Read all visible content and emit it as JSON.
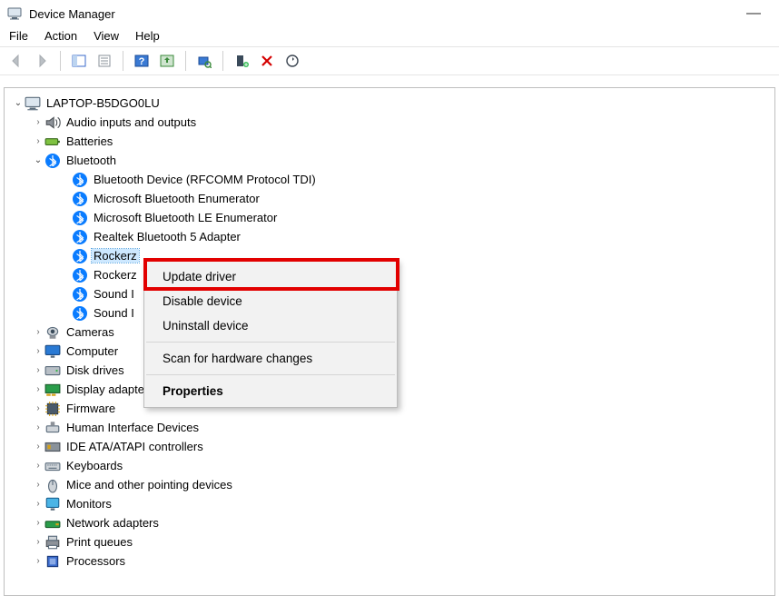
{
  "window": {
    "title": "Device Manager",
    "controls": {
      "minimize": "—"
    }
  },
  "menubar": [
    "File",
    "Action",
    "View",
    "Help"
  ],
  "toolbar": {
    "back": "Back",
    "forward": "Forward",
    "show_hidden": "Show hidden devices",
    "properties": "Properties",
    "help": "Help",
    "update": "Update",
    "uninstall": "Uninstall",
    "scan": "Scan for hardware changes",
    "add_legacy": "Add legacy hardware",
    "delete": "Delete",
    "refresh": "Refresh"
  },
  "tree": {
    "root": {
      "label": "LAPTOP-B5DGO0LU",
      "expanded": true
    },
    "categories": [
      {
        "id": "audio",
        "label": "Audio inputs and outputs",
        "icon": "speaker",
        "expanded": false
      },
      {
        "id": "battery",
        "label": "Batteries",
        "icon": "battery",
        "expanded": false
      },
      {
        "id": "bt",
        "label": "Bluetooth",
        "icon": "bluetooth",
        "expanded": true,
        "children": [
          {
            "label": "Bluetooth Device (RFCOMM Protocol TDI)"
          },
          {
            "label": "Microsoft Bluetooth Enumerator"
          },
          {
            "label": "Microsoft Bluetooth LE Enumerator"
          },
          {
            "label": "Realtek Bluetooth 5 Adapter"
          },
          {
            "label": "Rockerz",
            "selected": true
          },
          {
            "label": "Rockerz"
          },
          {
            "label": "Sound I"
          },
          {
            "label": "Sound I"
          }
        ]
      },
      {
        "id": "cameras",
        "label": "Cameras",
        "icon": "camera",
        "expanded": false
      },
      {
        "id": "computer",
        "label": "Computer",
        "icon": "monitor",
        "expanded": false
      },
      {
        "id": "disk",
        "label": "Disk drives",
        "icon": "disk",
        "expanded": false
      },
      {
        "id": "display",
        "label": "Display adapters",
        "icon": "gpu",
        "expanded": false
      },
      {
        "id": "firmware",
        "label": "Firmware",
        "icon": "chip",
        "expanded": false
      },
      {
        "id": "hid",
        "label": "Human Interface Devices",
        "icon": "hid",
        "expanded": false
      },
      {
        "id": "ide",
        "label": "IDE ATA/ATAPI controllers",
        "icon": "ide",
        "expanded": false
      },
      {
        "id": "keyboard",
        "label": "Keyboards",
        "icon": "keyboard",
        "expanded": false
      },
      {
        "id": "mice",
        "label": "Mice and other pointing devices",
        "icon": "mouse",
        "expanded": false
      },
      {
        "id": "monitors",
        "label": "Monitors",
        "icon": "monitor2",
        "expanded": false
      },
      {
        "id": "network",
        "label": "Network adapters",
        "icon": "network",
        "expanded": false
      },
      {
        "id": "print",
        "label": "Print queues",
        "icon": "printer",
        "expanded": false
      },
      {
        "id": "proc",
        "label": "Processors",
        "icon": "cpu",
        "expanded": false
      }
    ]
  },
  "context_menu": {
    "items": [
      {
        "label": "Update driver",
        "highlighted": true
      },
      {
        "label": "Disable device"
      },
      {
        "label": "Uninstall device"
      },
      {
        "sep": true
      },
      {
        "label": "Scan for hardware changes"
      },
      {
        "sep": true
      },
      {
        "label": "Properties",
        "bold": true
      }
    ]
  }
}
